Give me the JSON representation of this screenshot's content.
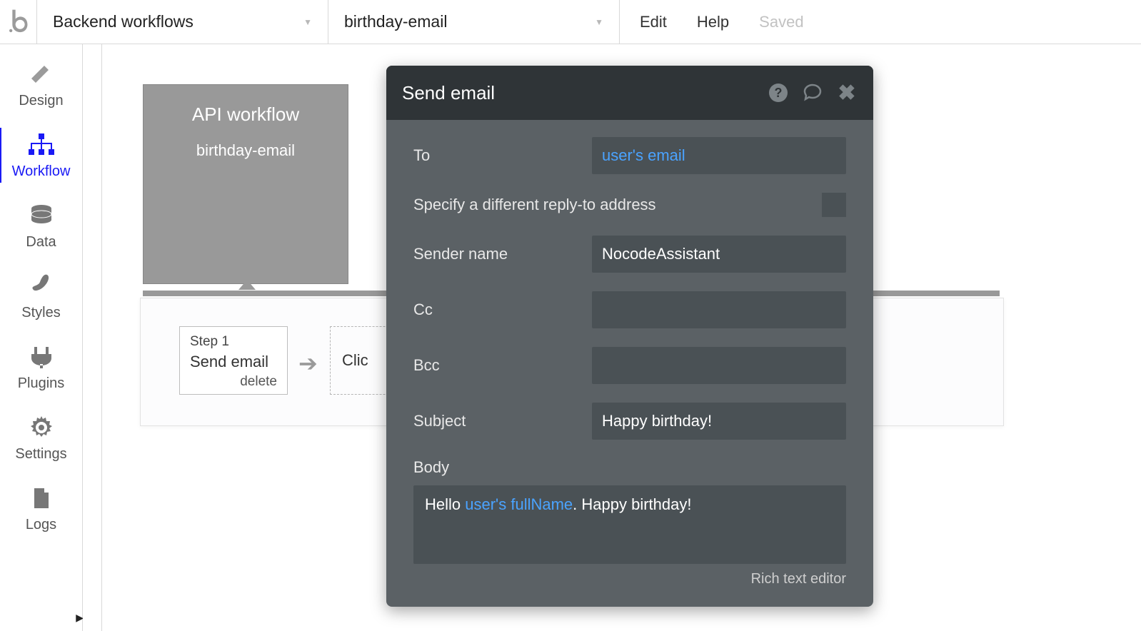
{
  "topbar": {
    "section": "Backend workflows",
    "workflow_name": "birthday-email",
    "links": {
      "edit": "Edit",
      "help": "Help"
    },
    "saved": "Saved"
  },
  "sidebar": {
    "items": [
      {
        "key": "design",
        "label": "Design"
      },
      {
        "key": "workflow",
        "label": "Workflow"
      },
      {
        "key": "data",
        "label": "Data"
      },
      {
        "key": "styles",
        "label": "Styles"
      },
      {
        "key": "plugins",
        "label": "Plugins"
      },
      {
        "key": "settings",
        "label": "Settings"
      },
      {
        "key": "logs",
        "label": "Logs"
      }
    ],
    "active": "workflow"
  },
  "event": {
    "title": "API workflow",
    "name": "birthday-email"
  },
  "step": {
    "num": "Step 1",
    "title": "Send email",
    "delete": "delete",
    "add_hint": "Clic"
  },
  "panel": {
    "title": "Send email",
    "fields": {
      "to_label": "To",
      "to_value": "user's email",
      "reply_to_label": "Specify a different reply-to address",
      "sender_name_label": "Sender name",
      "sender_name_value": "NocodeAssistant",
      "cc_label": "Cc",
      "cc_value": "",
      "bcc_label": "Bcc",
      "bcc_value": "",
      "subject_label": "Subject",
      "subject_value": "Happy birthday!",
      "body_label": "Body",
      "body_before": "Hello ",
      "body_dynamic": "user's fullName",
      "body_after": ". Happy birthday!",
      "rte_link": "Rich text editor"
    }
  }
}
